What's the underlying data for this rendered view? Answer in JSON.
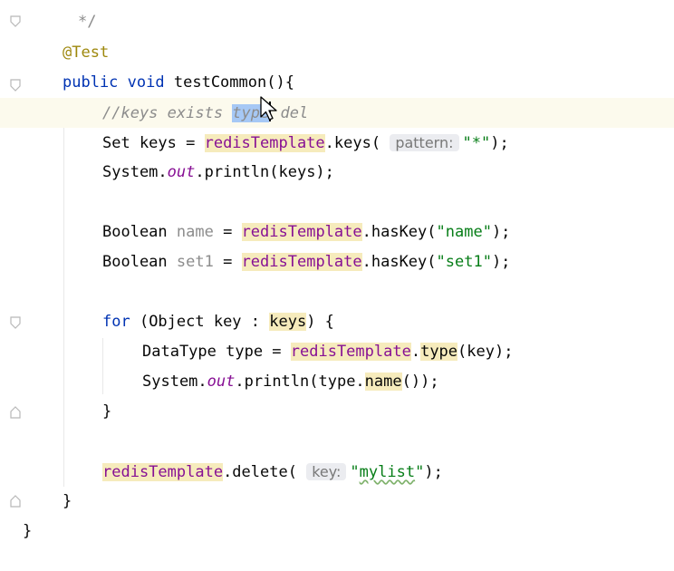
{
  "editor": {
    "lines": [
      {
        "text": "*/"
      },
      {
        "annotation": "@Test"
      },
      {
        "kw_public": "public",
        "kw_void": "void",
        "method": "testCommon(){"
      },
      {
        "comment_a": "//keys exists ",
        "comment_sel": "type",
        "comment_b": " del"
      },
      {
        "a": "Set keys = ",
        "tpl": "redisTemplate",
        "b": ".keys( ",
        "hint": "pattern:",
        "str": "\"*\"",
        "c": ");"
      },
      {
        "a": "System.",
        "out": "out",
        "b": ".println(keys);"
      },
      {
        "a": "Boolean ",
        "var": "name",
        "b": " = ",
        "tpl": "redisTemplate",
        "c": ".hasKey(",
        "str": "\"name\"",
        "d": ");"
      },
      {
        "a": "Boolean ",
        "var": "set1",
        "b": " = ",
        "tpl": "redisTemplate",
        "c": ".hasKey(",
        "str": "\"set1\"",
        "d": ");"
      },
      {
        "kw": "for",
        "a": " (Object key : ",
        "keys": "keys",
        "b": ") {"
      },
      {
        "a": "DataType type = ",
        "tpl": "redisTemplate",
        "b": ".",
        "type": "type",
        "c": "(key);"
      },
      {
        "a": "System.",
        "out": "out",
        "b": ".println(type.",
        "nm": "name",
        "c": "());"
      },
      {
        "text": "}"
      },
      {
        "tpl": "redisTemplate",
        "a": ".delete( ",
        "hint": "key:",
        "str_open": "\"",
        "str_word": "mylist",
        "str_close": "\"",
        "b": ");"
      },
      {
        "text": "}"
      },
      {
        "text": "}"
      }
    ]
  }
}
